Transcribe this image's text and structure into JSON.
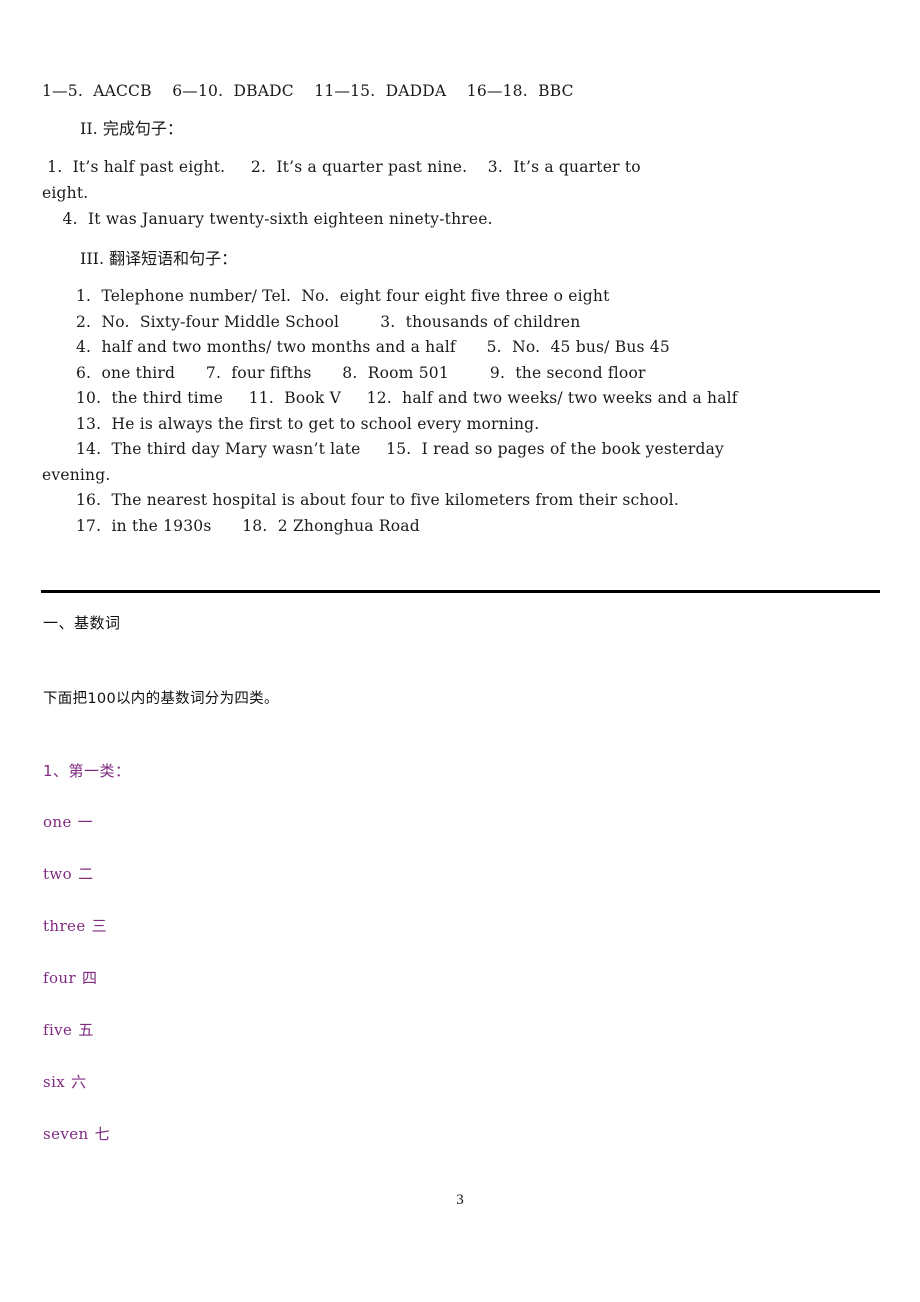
{
  "colors": {
    "text": "#1a1a1a",
    "accent_purple": "#802a80",
    "divider": "#000000",
    "background": "#ffffff"
  },
  "answer_key": {
    "multiple_choice_line": "1—5.  AACCB    6—10.  DBADC    11—15.  DADDA    16—18.  BBC",
    "section_2": {
      "heading": "II.  完成句子：",
      "lines": [
        " 1.  It’s half past eight.     2.  It’s a quarter past nine.    3.  It’s a quarter to",
        "eight.",
        "    4.  It was January twenty-sixth eighteen ninety-three."
      ]
    },
    "section_3": {
      "heading": "III.  翻译短语和句子：",
      "lines": [
        "1.  Telephone number/ Tel.  No.  eight four eight five three o eight",
        "2.  No.  Sixty-four Middle School        3.  thousands of children",
        "4.  half and two months/ two months and a half      5.  No.  45 bus/ Bus 45",
        "6.  one third      7.  four fifths      8.  Room 501        9.  the second floor",
        "10.  the third time     11.  Book V     12.  half and two weeks/ two weeks and a half",
        "13.  He is always the first to get to school every morning.",
        "14.  The third day Mary wasn’t late     15.  I read so pages of the book yesterday",
        "evening.",
        "16.  The nearest hospital is about four to five kilometers from their school.",
        "17.  in the 1930s      18.  2 Zhonghua Road"
      ]
    }
  },
  "lesson": {
    "heading": "一、基数词",
    "intro": "下面把100以内的基数词分为四类。",
    "subheading": "1、第一类：",
    "words": [
      {
        "en": "one",
        "cn": "一"
      },
      {
        "en": "two",
        "cn": "二"
      },
      {
        "en": "three",
        "cn": "三"
      },
      {
        "en": "four",
        "cn": "四"
      },
      {
        "en": "five",
        "cn": "五"
      },
      {
        "en": "six",
        "cn": "六"
      },
      {
        "en": "seven",
        "cn": "七"
      }
    ]
  },
  "footer": {
    "page_number": "3"
  }
}
